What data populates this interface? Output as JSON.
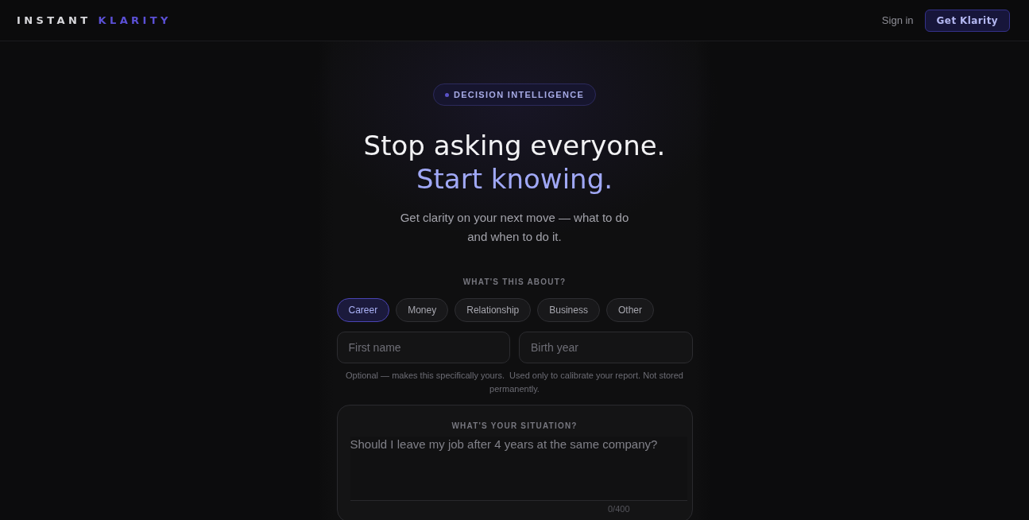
{
  "header": {
    "logo": {
      "first": "INSTANT",
      "second": "KLARITY"
    },
    "sign_in": "Sign in",
    "cta": "Get Klarity"
  },
  "hero": {
    "badge": "DECISION INTELLIGENCE",
    "title": "Stop asking everyone.",
    "title_accent": "Start knowing.",
    "subtitle": "Get clarity on your next move — what to do and when to do it."
  },
  "topic": {
    "label": "WHAT'S THIS ABOUT?",
    "options": [
      {
        "label": "Career",
        "selected": true
      },
      {
        "label": "Money",
        "selected": false
      },
      {
        "label": "Relationship",
        "selected": false
      },
      {
        "label": "Business",
        "selected": false
      },
      {
        "label": "Other",
        "selected": false
      }
    ]
  },
  "fields": [
    {
      "placeholder": "First name"
    },
    {
      "placeholder": "Birth year"
    }
  ],
  "note": "Optional — makes this specifically yours.  Used only to calibrate your report. Not stored permanently.",
  "situation": {
    "label": "WHAT'S YOUR SITUATION?",
    "placeholder": "Should I leave my job after 4 years at the same company?",
    "counter": "0/400"
  }
}
